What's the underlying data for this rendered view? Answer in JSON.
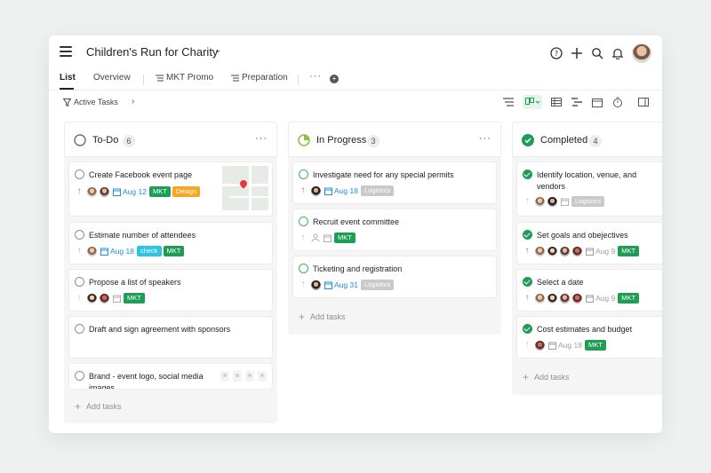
{
  "project": {
    "title": "Children's Run for Charity"
  },
  "tabs": [
    {
      "label": "List"
    },
    {
      "label": "Overview"
    },
    {
      "label": "MKT Promo"
    },
    {
      "label": "Preparation"
    }
  ],
  "tab_more": "···",
  "toolbar": {
    "filter_label": "Active Tasks"
  },
  "columns": [
    {
      "title": "To-Do",
      "count": "6",
      "add_label": "Add tasks",
      "cards": [
        {
          "title": "Create Facebook event page",
          "date": "Aug 12",
          "tags": [
            "MKT",
            "Design"
          ]
        },
        {
          "title": "Estimate number of attendees",
          "date": "Aug 18",
          "tags": [
            "check",
            "MKT"
          ]
        },
        {
          "title": "Propose a list of speakers",
          "tags": [
            "MKT"
          ]
        },
        {
          "title": "Draft and sign agreement with sponsors"
        },
        {
          "title": "Brand - event logo, social media images"
        }
      ]
    },
    {
      "title": "In Progress",
      "count": "3",
      "add_label": "Add tasks",
      "cards": [
        {
          "title": "Investigate need for any special permits",
          "date": "Aug 18",
          "tags": [
            "Logistics"
          ]
        },
        {
          "title": "Recruit event committee",
          "tags": [
            "MKT"
          ]
        },
        {
          "title": "Ticketing and registration",
          "date": "Aug 31",
          "tags": [
            "Logistics"
          ]
        }
      ]
    },
    {
      "title": "Completed",
      "count": "4",
      "add_label": "Add tasks",
      "cards": [
        {
          "title_line1": "Identify location, venue, and",
          "title_line2": "vendors",
          "tags": [
            "Logistics"
          ]
        },
        {
          "title": "Set goals and obejectives",
          "date": "Aug 9",
          "tags": [
            "MKT"
          ]
        },
        {
          "title": "Select a date",
          "date": "Aug 9",
          "tags": [
            "MKT"
          ]
        },
        {
          "title": "Cost estimates and budget",
          "date": "Aug 18",
          "tags": [
            "MKT"
          ]
        }
      ]
    }
  ],
  "colors": {
    "accent_green": "#1f9d55",
    "date_blue": "#1e90d6",
    "priority_red": "#d9534f",
    "priority_orange": "#f0a030"
  }
}
